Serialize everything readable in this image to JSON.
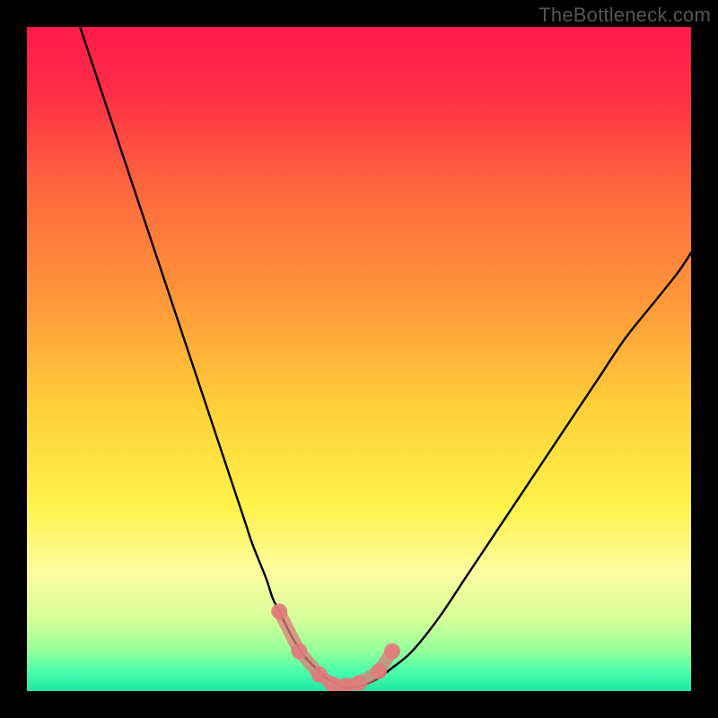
{
  "watermark": "TheBottleneck.com",
  "chart_data": {
    "type": "line",
    "title": "",
    "xlabel": "",
    "ylabel": "",
    "xlim": [
      0,
      100
    ],
    "ylim": [
      0,
      100
    ],
    "grid": false,
    "legend": false,
    "background_gradient": {
      "stops": [
        {
          "pos": 0.0,
          "color": "#ff1a4b"
        },
        {
          "pos": 0.1,
          "color": "#ff2e46"
        },
        {
          "pos": 0.25,
          "color": "#ff6a3e"
        },
        {
          "pos": 0.42,
          "color": "#ff9a3a"
        },
        {
          "pos": 0.58,
          "color": "#ffd23a"
        },
        {
          "pos": 0.72,
          "color": "#fff24a"
        },
        {
          "pos": 0.82,
          "color": "#fdfda0"
        },
        {
          "pos": 0.89,
          "color": "#d8ff9a"
        },
        {
          "pos": 0.94,
          "color": "#93ff9a"
        },
        {
          "pos": 0.97,
          "color": "#4bffad"
        },
        {
          "pos": 1.0,
          "color": "#1fe6a4"
        }
      ]
    },
    "series": [
      {
        "name": "bottleneck-curve",
        "color": "#000000",
        "x": [
          8,
          10,
          12,
          14,
          16,
          18,
          20,
          22,
          24,
          26,
          28,
          30,
          32,
          33,
          34,
          36,
          37,
          38,
          40,
          42,
          44,
          45,
          47,
          48,
          49,
          51,
          53,
          55,
          58,
          62,
          66,
          70,
          74,
          78,
          82,
          86,
          90,
          94,
          98,
          100
        ],
        "y": [
          100,
          94,
          88,
          82,
          76,
          70,
          64,
          58,
          52,
          46,
          40,
          34,
          28,
          25,
          22,
          17,
          14,
          12,
          8,
          5,
          3,
          2,
          1,
          0.5,
          0.5,
          1,
          2,
          3.5,
          6,
          11,
          17,
          23,
          29,
          35,
          41,
          47,
          53,
          58,
          63,
          66
        ]
      },
      {
        "name": "markers",
        "color": "#e07a7a",
        "type": "scatter",
        "x": [
          38,
          41,
          44,
          46,
          48,
          50,
          53,
          55
        ],
        "y": [
          12,
          6,
          2.5,
          1,
          0.8,
          1.2,
          3,
          6
        ]
      }
    ]
  }
}
